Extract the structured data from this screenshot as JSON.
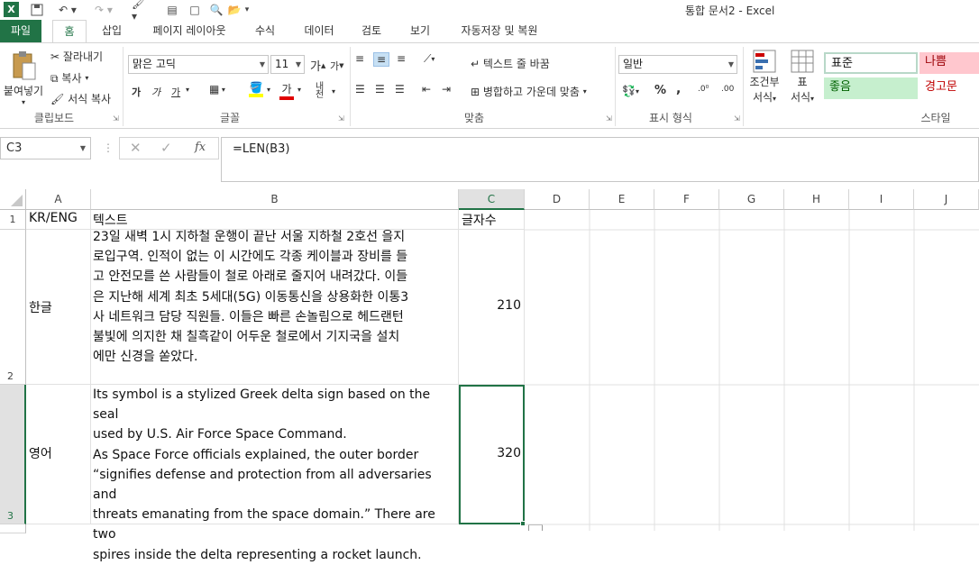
{
  "app": {
    "title": "통합 문서2 - Excel"
  },
  "tabs": [
    {
      "label": "파일"
    },
    {
      "label": "홈"
    },
    {
      "label": "삽입"
    },
    {
      "label": "페이지 레이아웃"
    },
    {
      "label": "수식"
    },
    {
      "label": "데이터"
    },
    {
      "label": "검토"
    },
    {
      "label": "보기"
    },
    {
      "label": "자동저장 및 복원"
    }
  ],
  "ribbon": {
    "clipboard": {
      "paste": "붙여넣기",
      "cut": "잘라내기",
      "copy": "복사",
      "format_painter": "서식 복사",
      "label": "클립보드"
    },
    "font": {
      "name": "맑은 고딕",
      "size": "11",
      "grow": "가",
      "shrink": "가",
      "bold": "가",
      "italic": "가",
      "underline": "가",
      "color_letter": "가",
      "phonetic": "내천",
      "label": "글꼴"
    },
    "alignment": {
      "wrap": "텍스트 줄 바꿈",
      "merge": "병합하고 가운데 맞춤",
      "label": "맞춤"
    },
    "number": {
      "format": "일반",
      "percent": "%",
      "comma": ",",
      "label": "표시 형식"
    },
    "styles": {
      "conditional": "조건부",
      "conditional2": "서식",
      "table": "표",
      "table2": "서식",
      "normal": "표준",
      "bad": "나쁨",
      "good": "좋음",
      "warning": "경고문",
      "label": "스타일"
    }
  },
  "formula_bar": {
    "name_box": "C3",
    "formula": "=LEN(B3)"
  },
  "columns": [
    "A",
    "B",
    "C",
    "D",
    "E",
    "F",
    "G",
    "H",
    "I",
    "J"
  ],
  "rows": [
    {
      "num": "1",
      "a": "KR/ENG",
      "b": "텍스트",
      "c": "글자수"
    },
    {
      "num": "2",
      "a": "한글",
      "b": "23일 새벽 1시 지하철 운행이 끝난 서울 지하철 2호선 을지\n로입구역. 인적이 없는 이 시간에도 각종 케이블과 장비를 들\n고 안전모를 쓴 사람들이 철로 아래로 줄지어 내려갔다. 이들\n은 지난해 세계 최초 5세대(5G) 이동통신을 상용화한 이통3\n사 네트워크 담당 직원들. 이들은 빠른 손놀림으로 헤드랜턴\n불빛에 의지한 채 칠흑같이 어두운 철로에서 기지국을 설치\n에만 신경을 쏟았다.",
      "c": "210"
    },
    {
      "num": "3",
      "a": "영어",
      "b": "Its symbol is a stylized Greek delta sign based on the seal\nused by U.S. Air Force Space Command.\nAs Space Force officials explained, the outer border\n“signifies defense and protection from all adversaries and\nthreats emanating from the space domain.” There are two\nspires inside the delta representing a rocket launch.",
      "c": "320"
    }
  ],
  "colors": {
    "accent": "#217346",
    "selection": "#217346",
    "good_bg": "#c6efce",
    "good_fg": "#006100",
    "bad_bg": "#ffc7ce",
    "bad_fg": "#9c0006"
  }
}
